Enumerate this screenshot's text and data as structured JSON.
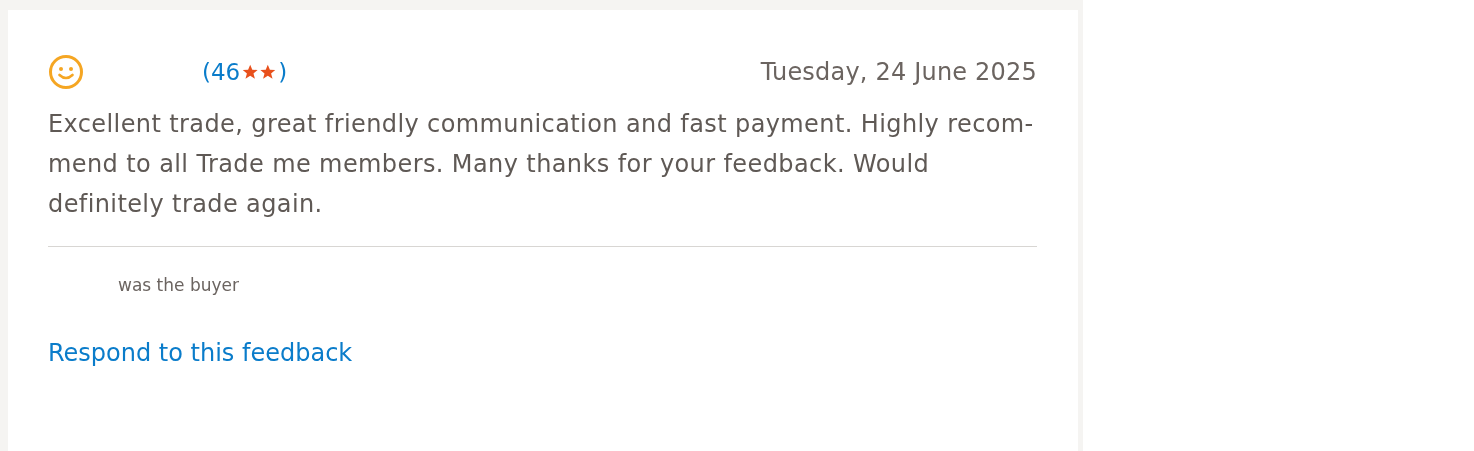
{
  "feedback": {
    "rating_count": "(46",
    "rating_close": ")",
    "date": "Tuesday, 24 June 2025",
    "comment": "Excellent trade, great friendly communication and fast payment. Highly recom-mend to all Trade me members. Many thanks for your feedback. Would definitely trade again.",
    "role": "was the buyer",
    "respond_link": "Respond to this feedback"
  }
}
